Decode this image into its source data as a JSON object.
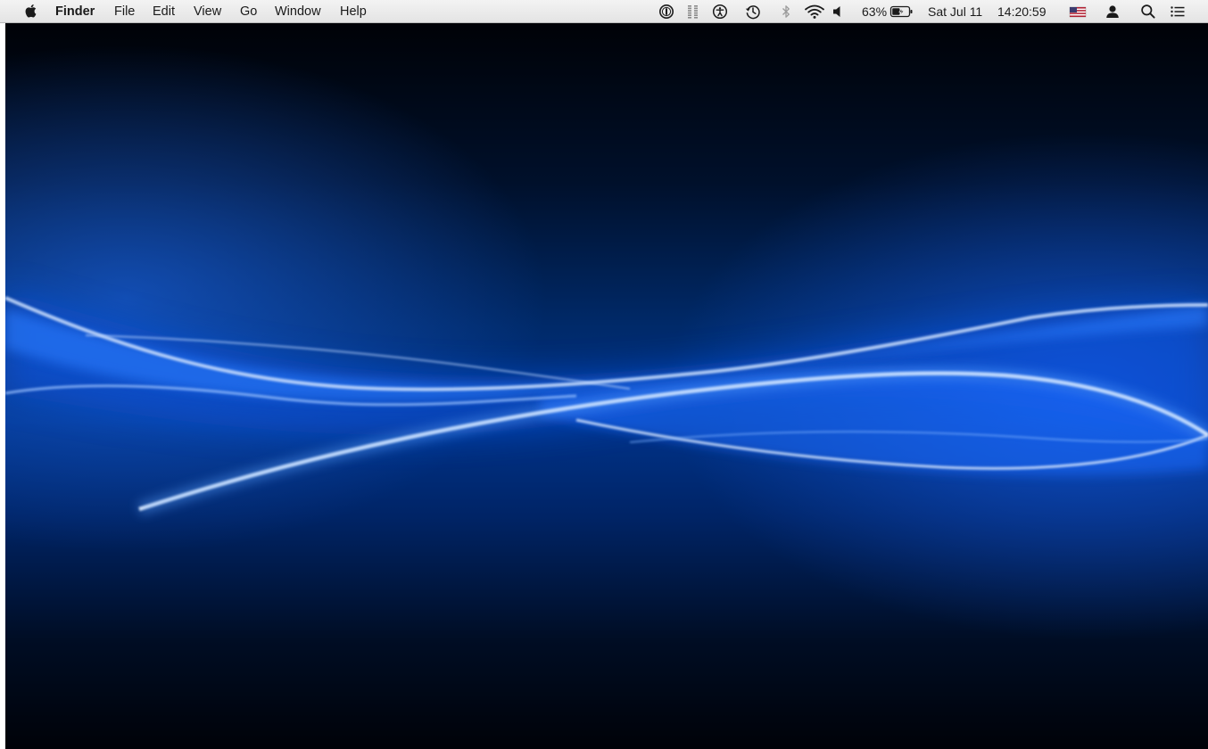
{
  "menubar": {
    "app_name": "Finder",
    "menus": [
      "File",
      "Edit",
      "View",
      "Go",
      "Window",
      "Help"
    ],
    "battery_percent": "63%",
    "date": "Sat Jul 11",
    "time": "14:20:59"
  },
  "icons": {
    "apple": "apple-logo-icon",
    "password_manager": "1password-icon",
    "equalizer": "equalizer-icon",
    "accessibility": "accessibility-icon",
    "time_machine": "time-machine-icon",
    "bluetooth": "bluetooth-icon",
    "wifi": "wifi-icon",
    "volume": "volume-icon",
    "battery": "battery-charging-icon",
    "input_source": "us-flag-icon",
    "user": "user-icon",
    "spotlight": "search-icon",
    "notification_center": "notification-center-icon"
  },
  "colors": {
    "menubar_bg": "#ececec",
    "wallpaper_dark": "#000814",
    "wallpaper_mid": "#003a8c",
    "wallpaper_glow": "#1a6dff",
    "wallpaper_highlight": "#ffffff"
  }
}
